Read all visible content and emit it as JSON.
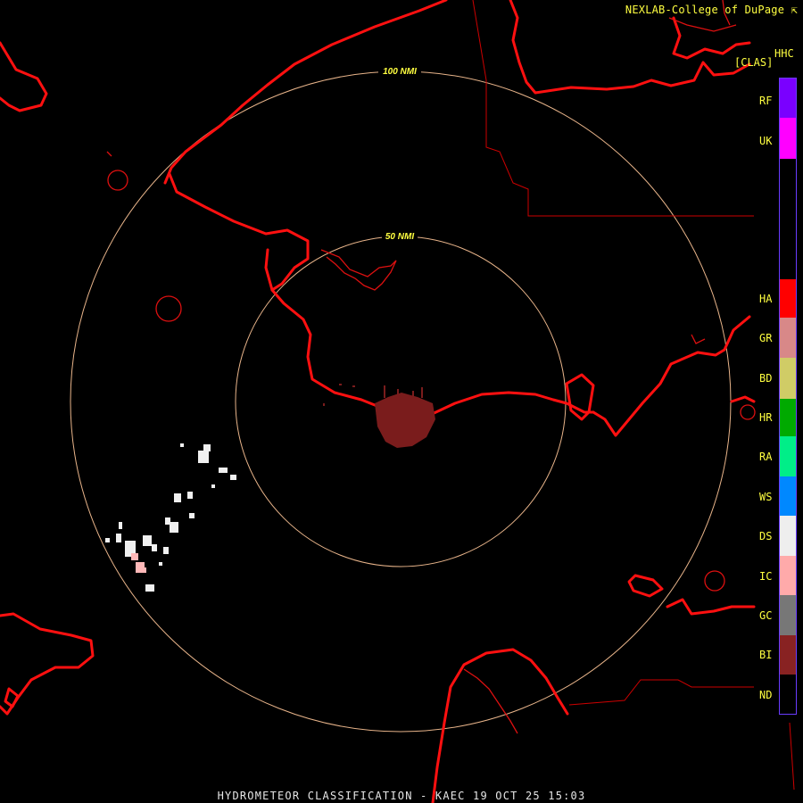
{
  "header": {
    "credit": "NEXLAB-College of DuPage",
    "product_code": "HHC",
    "product_class": "[CLAS]"
  },
  "range_rings": [
    {
      "label": "100 NMI",
      "radius_nmi": 100
    },
    {
      "label": "50 NMI",
      "radius_nmi": 50
    }
  ],
  "legend": [
    {
      "code": "RF",
      "color": "#7a00ff"
    },
    {
      "code": "UK",
      "color": "#ff00ff"
    },
    {
      "code": "HA",
      "color": "#ff0000"
    },
    {
      "code": "GR",
      "color": "#d88888"
    },
    {
      "code": "BD",
      "color": "#d0cc66"
    },
    {
      "code": "HR",
      "color": "#00aa00"
    },
    {
      "code": "RA",
      "color": "#00ee88"
    },
    {
      "code": "WS",
      "color": "#0088ff"
    },
    {
      "code": "DS",
      "color": "#eeeeee"
    },
    {
      "code": "IC",
      "color": "#ffaaaa"
    },
    {
      "code": "GC",
      "color": "#777777"
    },
    {
      "code": "BI",
      "color": "#882222"
    },
    {
      "code": "ND",
      "color": "#000000"
    }
  ],
  "caption": "HYDROMETEOR CLASSIFICATION - KAEC 19 OCT 25 15:03"
}
